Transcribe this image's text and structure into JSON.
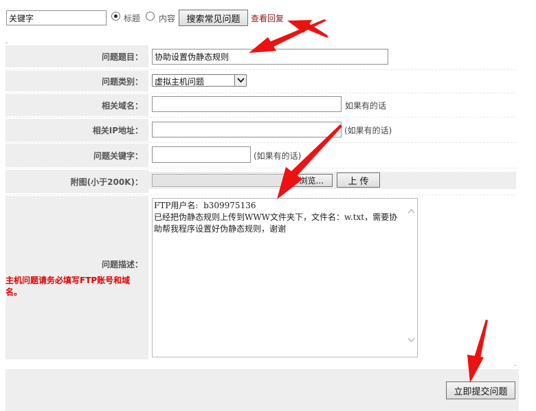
{
  "search": {
    "keyword_value": "关键字",
    "option_title": "标题",
    "option_content": "内容",
    "selected": "标题",
    "search_button": "搜索常见问题",
    "view_reply_link": "查看回复"
  },
  "form": {
    "subject": {
      "label": "问题题目：",
      "value": "协助设置伪静态规则"
    },
    "category": {
      "label": "问题类别：",
      "selected": "虚拟主机问题"
    },
    "domain": {
      "label": "相关域名：",
      "value": "",
      "hint": "如果有的话"
    },
    "ip": {
      "label": "相关IP地址：",
      "value": "",
      "hint": "(如果有的话)"
    },
    "keywords": {
      "label": "问题关键字：",
      "value": "",
      "hint": "(如果有的话)"
    },
    "attachment": {
      "label": "附图(小于200K)：",
      "browse_button": "浏览...",
      "upload_button": "上 传"
    },
    "description": {
      "label": "问题描述：",
      "warning": "主机问题请务必填写FTP账号和域名。",
      "value": "FTP用户名:  b309975136\n已经把伪静态规则上传到WWW文件夹下，文件名：w.txt，需要协助帮我程序设置好伪静态规则，谢谢"
    },
    "submit_button": "立即提交问题"
  },
  "colors": {
    "link": "#8b1a1a",
    "warning": "#e00000",
    "arrow": "#ee1111",
    "label_bg": "#eeeeee"
  }
}
